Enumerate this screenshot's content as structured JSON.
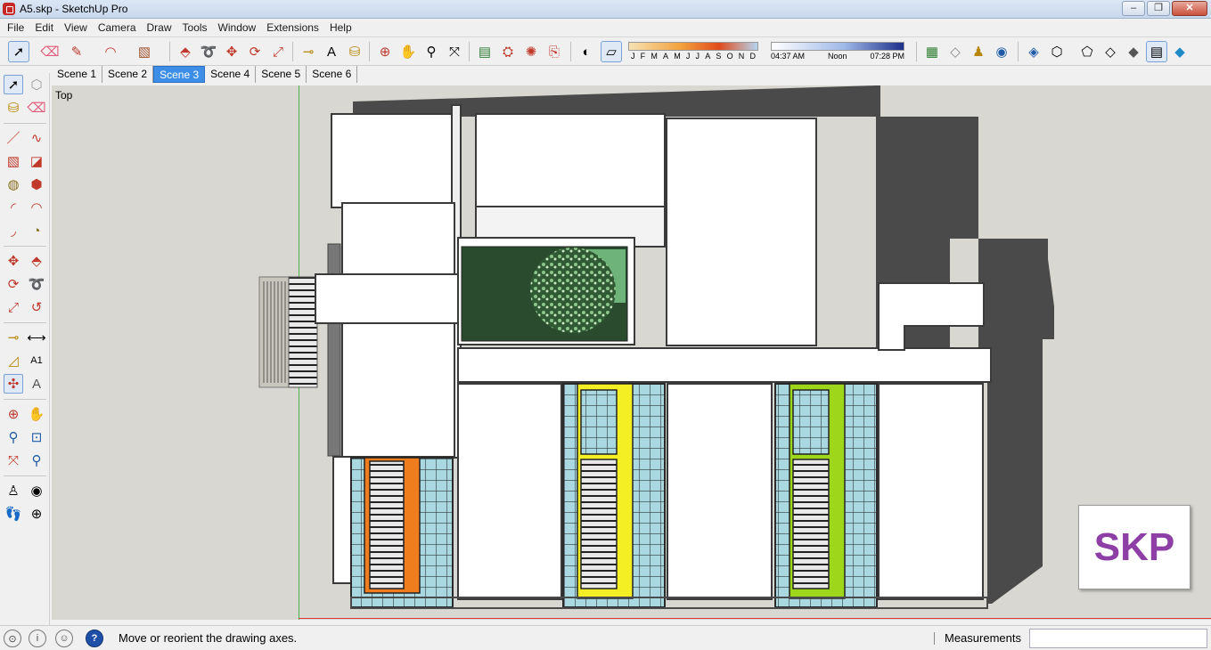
{
  "window": {
    "title": "A5.skp - SketchUp Pro",
    "controls": {
      "minimize": "–",
      "maximize": "❐",
      "close": "✕"
    }
  },
  "menu": [
    "File",
    "Edit",
    "View",
    "Camera",
    "Draw",
    "Tools",
    "Window",
    "Extensions",
    "Help"
  ],
  "shadow_settings": {
    "months": [
      "J",
      "F",
      "M",
      "A",
      "M",
      "J",
      "J",
      "A",
      "S",
      "O",
      "N",
      "D"
    ],
    "time_start": "04:37 AM",
    "time_mid": "Noon",
    "time_end": "07:28 PM"
  },
  "scenes": {
    "tabs": [
      "Scene 1",
      "Scene 2",
      "Scene 3",
      "Scene 4",
      "Scene 5",
      "Scene 6"
    ],
    "active": "Scene 3"
  },
  "viewport": {
    "view_name": "Top",
    "background": "#d9d7d1"
  },
  "watermark": {
    "text": "SKP",
    "color": "#8e3fa6"
  },
  "status": {
    "message": "Move or reorient the drawing axes.",
    "measurements_label": "Measurements",
    "measurements_value": ""
  }
}
